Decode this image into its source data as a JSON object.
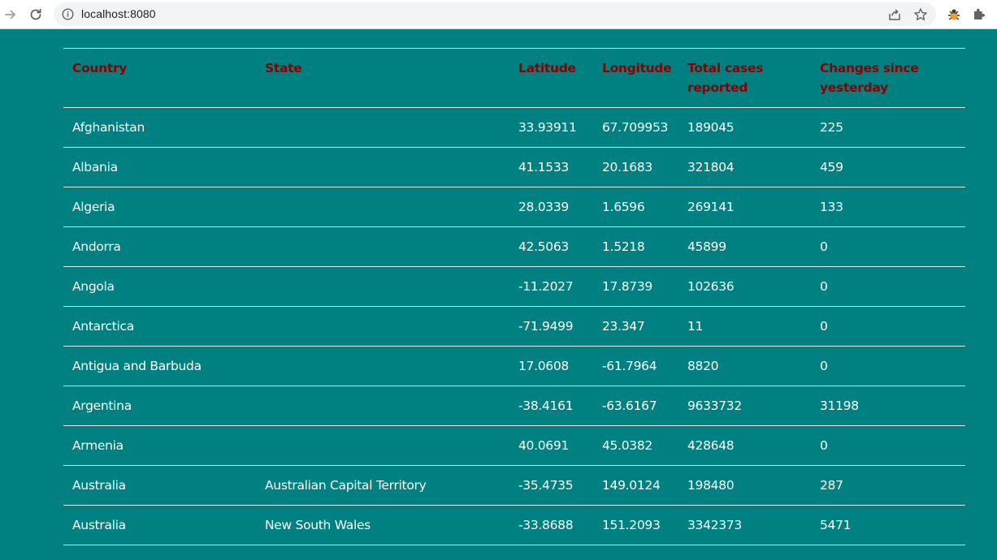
{
  "browser": {
    "url": "localhost:8080",
    "icons": [
      "back-arrow-icon",
      "reload-icon",
      "info-icon",
      "share-icon",
      "star-icon",
      "extension-bug-icon",
      "puzzle-icon"
    ]
  },
  "colors": {
    "page_background": "#008080",
    "header_text": "#8b0000",
    "cell_text": "#ffffff",
    "row_border": "#e8e8e8"
  },
  "table": {
    "headers": {
      "country": "Country",
      "state": "State",
      "latitude": "Latitude",
      "longitude": "Longitude",
      "total": "Total cases reported",
      "change": "Changes since yesterday"
    },
    "rows": [
      {
        "country": "Afghanistan",
        "state": "",
        "latitude": "33.93911",
        "longitude": "67.709953",
        "total": "189045",
        "change": "225"
      },
      {
        "country": "Albania",
        "state": "",
        "latitude": "41.1533",
        "longitude": "20.1683",
        "total": "321804",
        "change": "459"
      },
      {
        "country": "Algeria",
        "state": "",
        "latitude": "28.0339",
        "longitude": "1.6596",
        "total": "269141",
        "change": "133"
      },
      {
        "country": "Andorra",
        "state": "",
        "latitude": "42.5063",
        "longitude": "1.5218",
        "total": "45899",
        "change": "0"
      },
      {
        "country": "Angola",
        "state": "",
        "latitude": "-11.2027",
        "longitude": "17.8739",
        "total": "102636",
        "change": "0"
      },
      {
        "country": "Antarctica",
        "state": "",
        "latitude": "-71.9499",
        "longitude": "23.347",
        "total": "11",
        "change": "0"
      },
      {
        "country": "Antigua and Barbuda",
        "state": "",
        "latitude": "17.0608",
        "longitude": "-61.7964",
        "total": "8820",
        "change": "0"
      },
      {
        "country": "Argentina",
        "state": "",
        "latitude": "-38.4161",
        "longitude": "-63.6167",
        "total": "9633732",
        "change": "31198"
      },
      {
        "country": "Armenia",
        "state": "",
        "latitude": "40.0691",
        "longitude": "45.0382",
        "total": "428648",
        "change": "0"
      },
      {
        "country": "Australia",
        "state": "Australian Capital Territory",
        "latitude": "-35.4735",
        "longitude": "149.0124",
        "total": "198480",
        "change": "287"
      },
      {
        "country": "Australia",
        "state": "New South Wales",
        "latitude": "-33.8688",
        "longitude": "151.2093",
        "total": "3342373",
        "change": "5471"
      }
    ]
  }
}
